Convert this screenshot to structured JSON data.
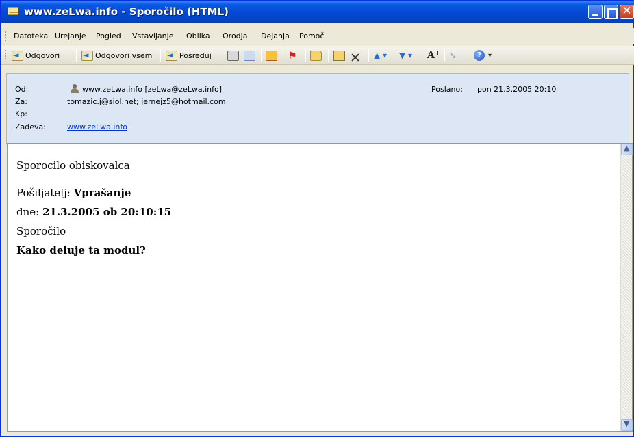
{
  "window": {
    "title": "www.zeLwa.info  - Sporočilo (HTML)"
  },
  "menu": {
    "items": [
      "Datoteka",
      "Urejanje",
      "Pogled",
      "Vstavljanje",
      "Oblika",
      "Orodja",
      "Dejanja",
      "Pomoč"
    ]
  },
  "toolbar": {
    "reply": "Odgovori",
    "reply_all": "Odgovori vsem",
    "forward": "Posreduj"
  },
  "header": {
    "from_label": "Od:",
    "from_value": "www.zeLwa.info [zeLwa@zeLwa.info]",
    "to_label": "Za:",
    "to_value": "tomazic.j@siol.net; jernejz5@hotmail.com",
    "cc_label": "Kp:",
    "cc_value": "",
    "subject_label": "Zadeva:",
    "subject_value": "www.zeLwa.info",
    "sent_label": "Poslano:",
    "sent_value": "pon 21.3.2005 20:10"
  },
  "body": {
    "greeting": "Sporocilo obiskovalca",
    "sender_label": "Pošiljatelj: ",
    "sender_value": "Vprašanje",
    "date_label": "dne: ",
    "date_value": "21.3.2005 ob 20:10:15",
    "message_label": "Sporočilo",
    "message_value": "Kako deluje ta modul?"
  },
  "colors": {
    "titlebar": "#0548d4",
    "header_bg": "#dde6f4",
    "link": "#0033cc"
  }
}
